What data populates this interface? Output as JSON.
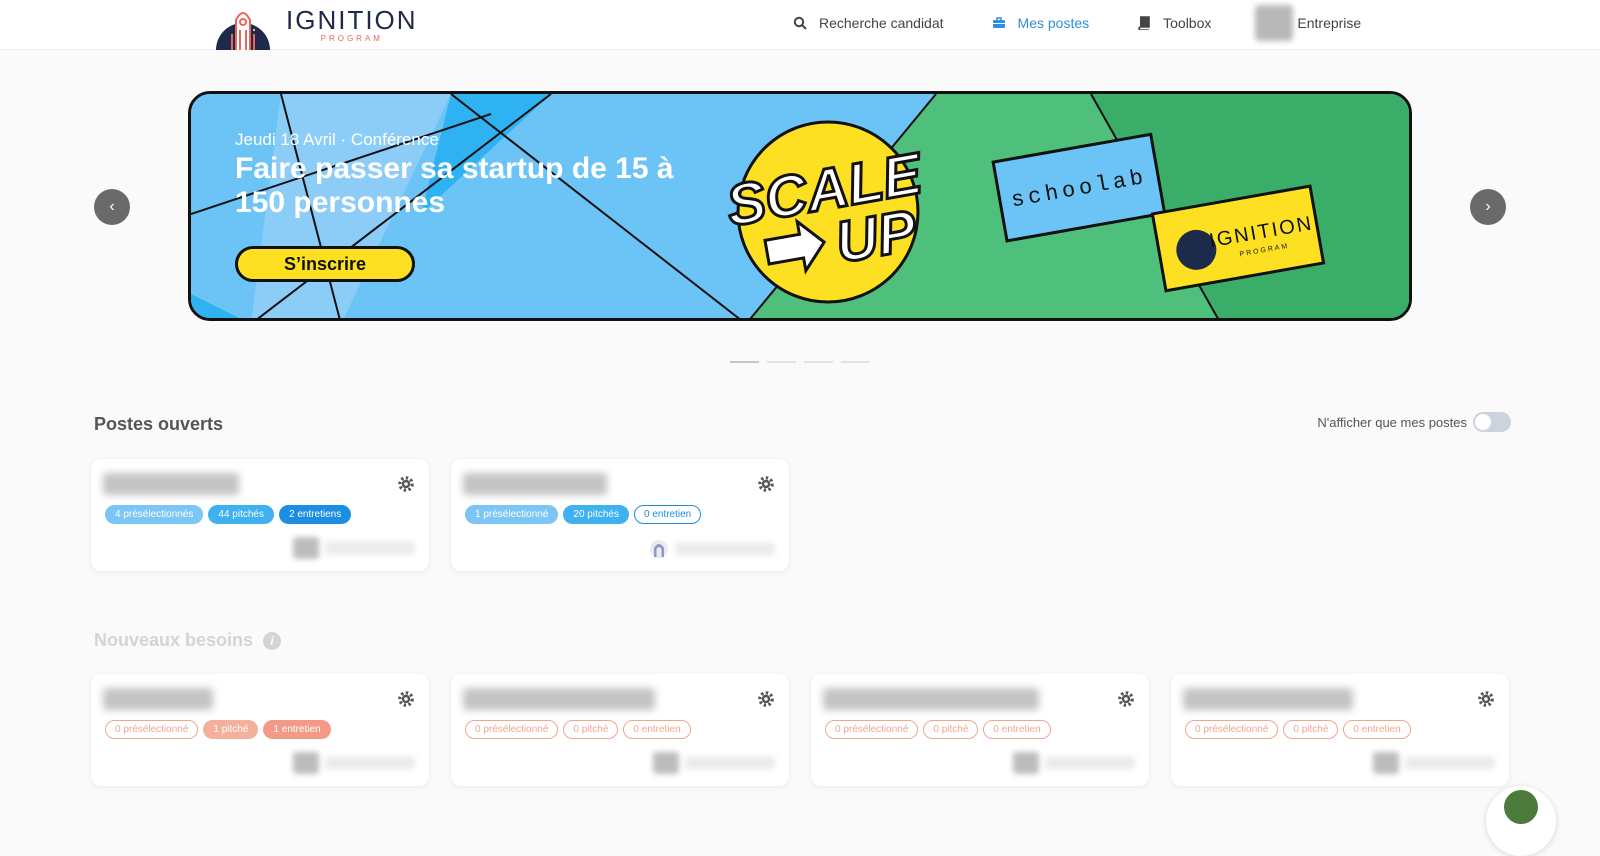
{
  "header": {
    "logo_title": "IGNITION",
    "logo_subtitle": "PROGRAM",
    "nav": [
      {
        "label": "Recherche candidat",
        "icon": "search-icon"
      },
      {
        "label": "Mes postes",
        "icon": "briefcase-icon",
        "active": true
      },
      {
        "label": "Toolbox",
        "icon": "book-icon"
      },
      {
        "label": "Entreprise",
        "icon": "company-avatar"
      }
    ]
  },
  "carousel": {
    "prev": "‹",
    "next": "›",
    "slide": {
      "date": "Jeudi 18 Avril · Conférence",
      "title": "Faire passer sa startup de 15 à 150 personnes",
      "cta": "S’inscrire",
      "badge_line1": "SCALE",
      "badge_line2": "UP",
      "partner1": "schoolab",
      "partner2_title": "IGNITION",
      "partner2_sub": "PROGRAM"
    },
    "dots": 4,
    "active_dot": 0
  },
  "open_positions": {
    "title": "Postes ouverts",
    "toggle_label": "N'afficher que mes postes",
    "cards": [
      {
        "badges": [
          "4 présélectionnés",
          "44 pitchés",
          "2 entretiens"
        ]
      },
      {
        "badges": [
          "1 présélectionné",
          "20 pitchés",
          "0 entretien"
        ]
      }
    ]
  },
  "new_needs": {
    "title": "Nouveaux besoins",
    "info": "i",
    "cards": [
      {
        "badges": [
          "0 présélectionné",
          "1 pitché",
          "1 entretien"
        ]
      },
      {
        "badges": [
          "0 présélectionné",
          "0 pitché",
          "0 entretien"
        ]
      },
      {
        "badges": [
          "0 présélectionné",
          "0 pitché",
          "0 entretien"
        ]
      },
      {
        "badges": [
          "0 présélectionné",
          "0 pitché",
          "0 entretien"
        ]
      }
    ]
  },
  "colors": {
    "accent": "#2d8fe0",
    "banner_blue": "#6cc4f6",
    "banner_green": "#3fb36f",
    "banner_yellow": "#fde022",
    "needs_orange": "#f1a58f"
  }
}
